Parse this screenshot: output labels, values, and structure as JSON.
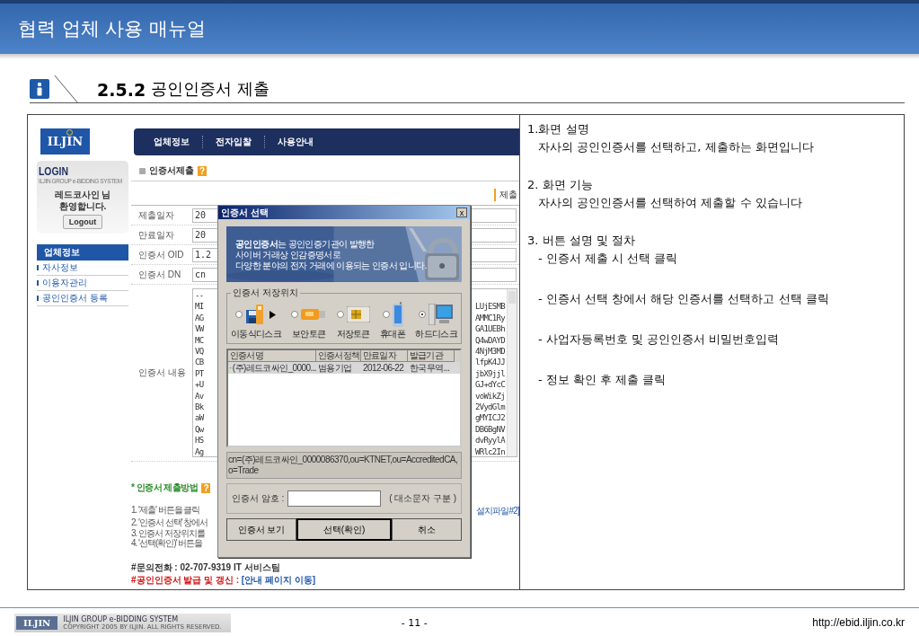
{
  "header": {
    "title": "협력 업체 사용 매뉴얼"
  },
  "section": {
    "number": "2.5.2",
    "title": "공인인증서 제출"
  },
  "screenshot": {
    "logo": "ILJIN",
    "nav": [
      "업체정보",
      "전자입찰",
      "사용안내"
    ],
    "login": {
      "title": "LOGIN",
      "subtitle": "ILJIN GROUP e-BIDDING SYSTEM",
      "user": "레드코사인 님",
      "greeting": "환영합니다.",
      "button": "Logout"
    },
    "sidebar": {
      "heading": "업체정보",
      "items": [
        "자사정보",
        "이용자관리",
        "공인인증서 등록"
      ]
    },
    "page_title": "인증서제출",
    "help": "?",
    "submit_button": "제출",
    "fields": [
      {
        "label": "제출일자",
        "value": "20"
      },
      {
        "label": "만료일자",
        "value": "20"
      },
      {
        "label": "인증서 OID",
        "value": "1.2"
      },
      {
        "label": "인증서 DN",
        "value": "cn"
      }
    ],
    "content_field": {
      "label": "인증서 내용",
      "left_lines": [
        "--",
        "MI",
        "AG",
        "VW",
        "MC",
        "VQ",
        "CB",
        "PT",
        "+U",
        "Av",
        "Bk",
        "aW",
        "Qw",
        "HS",
        "Ag"
      ],
      "right_lines": [
        "LUjESMB",
        "AMMC1Ry",
        "GA1UEBh",
        "Q4wDAYD",
        "4NjM3MD",
        "lfpK4JJ",
        "jbX9jjl",
        "GJ+dYcC",
        "voWikZj",
        "2VydGlm",
        "gMYICJ2",
        "DB6BgNV",
        "dvRyylA",
        "WRlc2In"
      ]
    },
    "method": {
      "title": "* 인증서 제출방법",
      "steps": [
        "1. '제출' 버튼을 클릭",
        "2. '인증서 선택' 창에서",
        "3. 인증서 저장위치를",
        "4. '선택(확인)' 버튼을"
      ],
      "link": "설치파일#2]"
    },
    "contact": "#문의전화 : 02-707-9319 IT 서비스팀",
    "renew": {
      "label": "#공인인증서 발급 및 갱신 : ",
      "link": "[안내 페이지 이동]"
    }
  },
  "dialog": {
    "title": "인증서 선택",
    "close": "x",
    "banner": [
      "**공인인증서**는 공인인증기관이 발행한",
      "사이버 거래상 인감증명서로",
      "다양한 분야의 전자 거래에 이용되는 인증서 입니다."
    ],
    "storage": {
      "legend": "인증서 저장위치",
      "options": [
        {
          "kind": "removable",
          "label": "이동식디스크",
          "selected": false
        },
        {
          "kind": "token",
          "label": "보안토큰",
          "selected": false
        },
        {
          "kind": "smartcard",
          "label": "저장토큰",
          "selected": false
        },
        {
          "kind": "phone",
          "label": "휴대폰",
          "selected": false
        },
        {
          "kind": "harddisk",
          "label": "하드디스크",
          "selected": true
        }
      ]
    },
    "columns": [
      "인증서명",
      "인증서정책",
      "만료일자",
      "발급기관"
    ],
    "rows": [
      {
        "cells": [
          "(주)레드코싸인_0000...",
          "범용기업",
          "2012-06-22",
          "한국무역..."
        ],
        "selected": true
      }
    ],
    "dn": "cn=(주)레드코싸인_0000086370,ou=KTNET,ou=AccreditedCA,o=Trade",
    "password": {
      "label": "인증서 암호 :",
      "hint": "( 대소문자 구분 )"
    },
    "buttons": [
      "인증서 보기",
      "선택(확인)",
      "취소"
    ]
  },
  "description": [
    {
      "heading": "1.화면 설명",
      "lines": [
        "자사의 공인인증서를 선택하고, 제출하는 화면입니다"
      ]
    },
    {
      "heading": "2. 화면 기능",
      "lines": [
        "자사의 공인인증서를 선택하여 제출할 수 있습니다"
      ]
    },
    {
      "heading": "3. 버튼 설명 및 절차",
      "lines": [
        "- 인증서 제출 시 선택  클릭",
        "- 인증서 선택 창에서 해당 인증서를 선택하고 선택 클릭",
        "- 사업자등록번호 및 공인인증서 비밀번호입력",
        "- 정보 확인 후 제출  클릭"
      ]
    }
  ],
  "footer": {
    "logo": "ILJIN",
    "system": "ILJIN GROUP e-BIDDING SYSTEM",
    "copyright": "COPYRIGHT 2005 BY ILJIN. ALL RIGHTS RESERVED.",
    "page": "- 11 -",
    "url": "http://ebid.iljin.co.kr"
  }
}
